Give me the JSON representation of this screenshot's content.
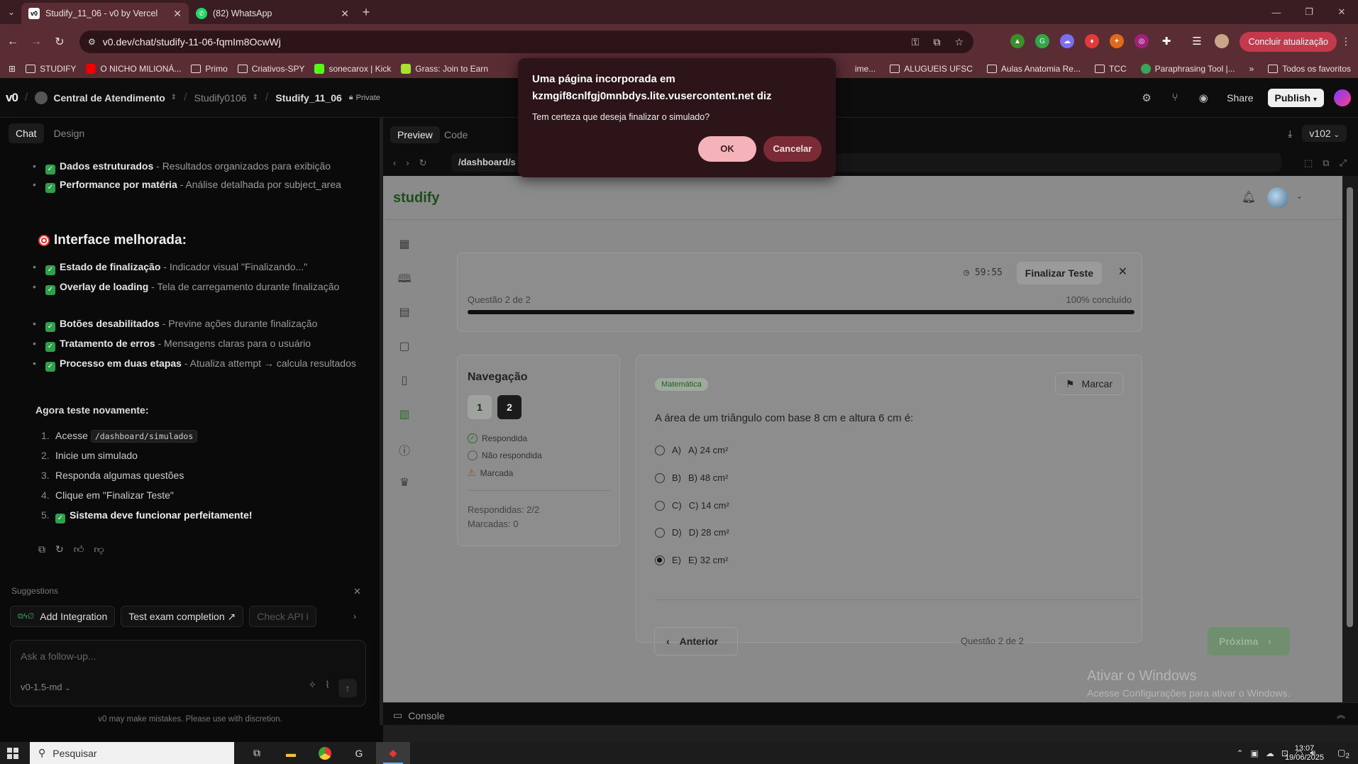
{
  "browser": {
    "tabs": [
      {
        "title": "Studify_11_06 - v0 by Vercel",
        "icon": "v0-favicon",
        "active": true
      },
      {
        "title": "(82) WhatsApp",
        "icon": "whatsapp-icon",
        "active": false
      }
    ],
    "url": "v0.dev/chat/studify-11-06-fqmIm8OcwWj",
    "update_button": "Concluir atualização",
    "bookmarks": [
      "STUDIFY",
      "O NICHO MILIONÁ...",
      "Primo",
      "Criativos-SPY",
      "sonecarox | Kick",
      "Grass: Join to Earn"
    ],
    "bookmarks_right": [
      "ime...",
      "ALUGUEIS UFSC",
      "Aulas Anatomia Re...",
      "TCC",
      "Paraphrasing Tool |..."
    ],
    "bookmarks_more": "»",
    "bookmarks_all": "Todos os favoritos"
  },
  "v0": {
    "logo": "v0",
    "breadcrumbs": [
      "Central de Atendimento",
      "Studify0106",
      "Studify_11_06"
    ],
    "private": "Private",
    "share": "Share",
    "publish": "Publish"
  },
  "chat": {
    "tabs": [
      "Chat",
      "Design"
    ],
    "items_top": [
      {
        "bold": "Dados estruturados",
        "rest": " - Resultados organizados para exibição"
      },
      {
        "bold": "Performance por matéria",
        "rest": " - Análise detalhada por subject_area"
      }
    ],
    "heading": "Interface melhorada:",
    "items_ui": [
      {
        "bold": "Estado de finalização",
        "rest": " - Indicador visual \"Finalizando...\""
      },
      {
        "bold": "Overlay de loading",
        "rest": " - Tela de carregamento durante finalização"
      },
      {
        "bold": "Botões desabilitados",
        "rest": " - Previne ações durante finalização"
      },
      {
        "bold": "Tratamento de erros",
        "rest": " - Mensagens claras para o usuário"
      },
      {
        "bold": "Processo em duas etapas",
        "rest": " - Atualiza attempt → calcula resultados"
      }
    ],
    "try_again": "Agora teste novamente:",
    "steps": [
      {
        "n": "1.",
        "pre": "Acesse ",
        "code": "/dashboard/simulados"
      },
      {
        "n": "2.",
        "pre": "Inicie um simulado"
      },
      {
        "n": "3.",
        "pre": "Responda algumas questões"
      },
      {
        "n": "4.",
        "pre": "Clique em \"Finalizar Teste\""
      },
      {
        "n": "5.",
        "pre": "Sistema deve funcionar perfeitamente!"
      }
    ],
    "suggestions_title": "Suggestions",
    "suggestions": [
      "Add Integration",
      "Test exam completion ↗",
      "Check API i"
    ],
    "placeholder": "Ask a follow-up...",
    "model": "v0-1.5-md",
    "disclaimer": "v0 may make mistakes. Please use with discretion."
  },
  "preview": {
    "tabs": [
      "Preview",
      "Code"
    ],
    "version": "v102",
    "path": "/dashboard/s",
    "console": "Console"
  },
  "app": {
    "brand": "studify",
    "timer": "59:55",
    "finish": "Finalizar Teste",
    "question_of": "Questão 2 de 2",
    "progress_label": "100% concluído",
    "progress": 1.0,
    "nav_title": "Navegação",
    "nav_buttons": [
      "1",
      "2"
    ],
    "legend": [
      "Respondida",
      "Não respondida",
      "Marcada"
    ],
    "answered": "Respondidas: 2/2",
    "marked": "Marcadas: 0",
    "subject": "Matemática",
    "mark": "Marcar",
    "question": "A área de um triângulo com base 8 cm e altura 6 cm é:",
    "options": [
      {
        "letter": "A)",
        "text": "A) 24 cm²",
        "selected": false
      },
      {
        "letter": "B)",
        "text": "B) 48 cm²",
        "selected": false
      },
      {
        "letter": "C)",
        "text": "C) 14 cm²",
        "selected": false
      },
      {
        "letter": "D)",
        "text": "D) 28 cm²",
        "selected": false
      },
      {
        "letter": "E)",
        "text": "E) 32 cm²",
        "selected": true
      }
    ],
    "prev": "Anterior",
    "next": "Próxima"
  },
  "dialog": {
    "title": "Uma página incorporada em kzmgif8cnlfgj0mnbdys.lite.vusercontent.net diz",
    "message": "Tem certeza que deseja finalizar o simulado?",
    "ok": "OK",
    "cancel": "Cancelar"
  },
  "watermark": {
    "line1": "Ativar o Windows",
    "line2": "Acesse Configurações para ativar o Windows."
  },
  "taskbar": {
    "search": "Pesquisar",
    "time": "13:07",
    "date": "19/06/2025",
    "notifications": "2"
  }
}
